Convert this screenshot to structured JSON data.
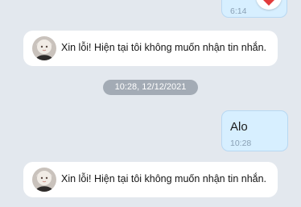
{
  "messages": {
    "top_bubble": {
      "time": "6:14"
    },
    "auto_reply_1": {
      "text": "Xin lỗi! Hiện tại tôi không muốn nhận tin nhắn."
    },
    "time_divider": {
      "label": "10:28, 12/12/2021"
    },
    "alo_bubble": {
      "text": "Alo",
      "time": "10:28"
    },
    "auto_reply_2": {
      "text": "Xin lỗi! Hiện tại tôi không muốn nhận tin nhắn."
    }
  },
  "reaction": {
    "icon": "heart-icon",
    "color": "#e23b3b"
  },
  "colors": {
    "background": "#e3e8ee",
    "outgoing_bubble": "#d7efff",
    "incoming_bubble": "#ffffff",
    "divider_pill": "#a3abb5"
  }
}
